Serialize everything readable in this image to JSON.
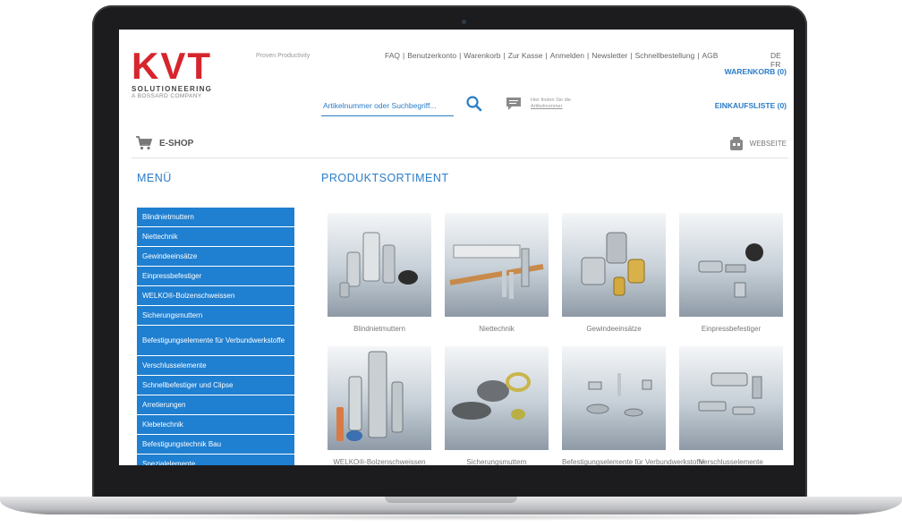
{
  "header": {
    "logo_letters": [
      "K",
      "V",
      "T"
    ],
    "logo_sub": "SOLUTIONEERING",
    "logo_sub2": "A BOSSARD COMPANY",
    "tagline": "Proven Productivity",
    "top_links": [
      "FAQ",
      "Benutzerkonto",
      "Warenkorb",
      "Zur Kasse",
      "Anmelden",
      "Newsletter",
      "Schnellbestellung",
      "AGB"
    ],
    "languages": [
      "DE",
      "FR"
    ],
    "warenkorb": "WARENKORB (0)",
    "einkaufsliste": "EINKAUFSLISTE (0)",
    "search_placeholder": "Artikelnummer oder Suchbegriff...",
    "hint_line1": "Hier finden Sie die",
    "hint_line2": "Artikelnummer",
    "eshop_label": "E-SHOP",
    "website_label": "WEBSEITE"
  },
  "menu": {
    "title": "MENÜ",
    "items": [
      "Blindnietmuttern",
      "Niettechnik",
      "Gewindeeinsätze",
      "Einpressbefestiger",
      "WELKO®-Bolzenschweissen",
      "Sicherungsmuttern",
      "Befestigungselemente für Verbundwerkstoffe",
      "Verschlusselemente",
      "Schnellbefestiger und Clipse",
      "Arretierungen",
      "Klebetechnik",
      "Befestigungstechnik Bau",
      "Spezialelemente"
    ]
  },
  "products": {
    "title": "PRODUKTSORTIMENT",
    "items": [
      "Blindnietmuttern",
      "Niettechnik",
      "Gewindeeinsätze",
      "Einpressbefestiger",
      "WELKO®-Bolzenschweissen",
      "Sicherungsmuttern",
      "Befestigungselemente für Verbundwerkstoffe",
      "Verschlusselemente"
    ]
  },
  "colors": {
    "brand_red": "#d7252d",
    "accent_blue": "#1f7fd0",
    "link_blue": "#2a7dc7"
  }
}
